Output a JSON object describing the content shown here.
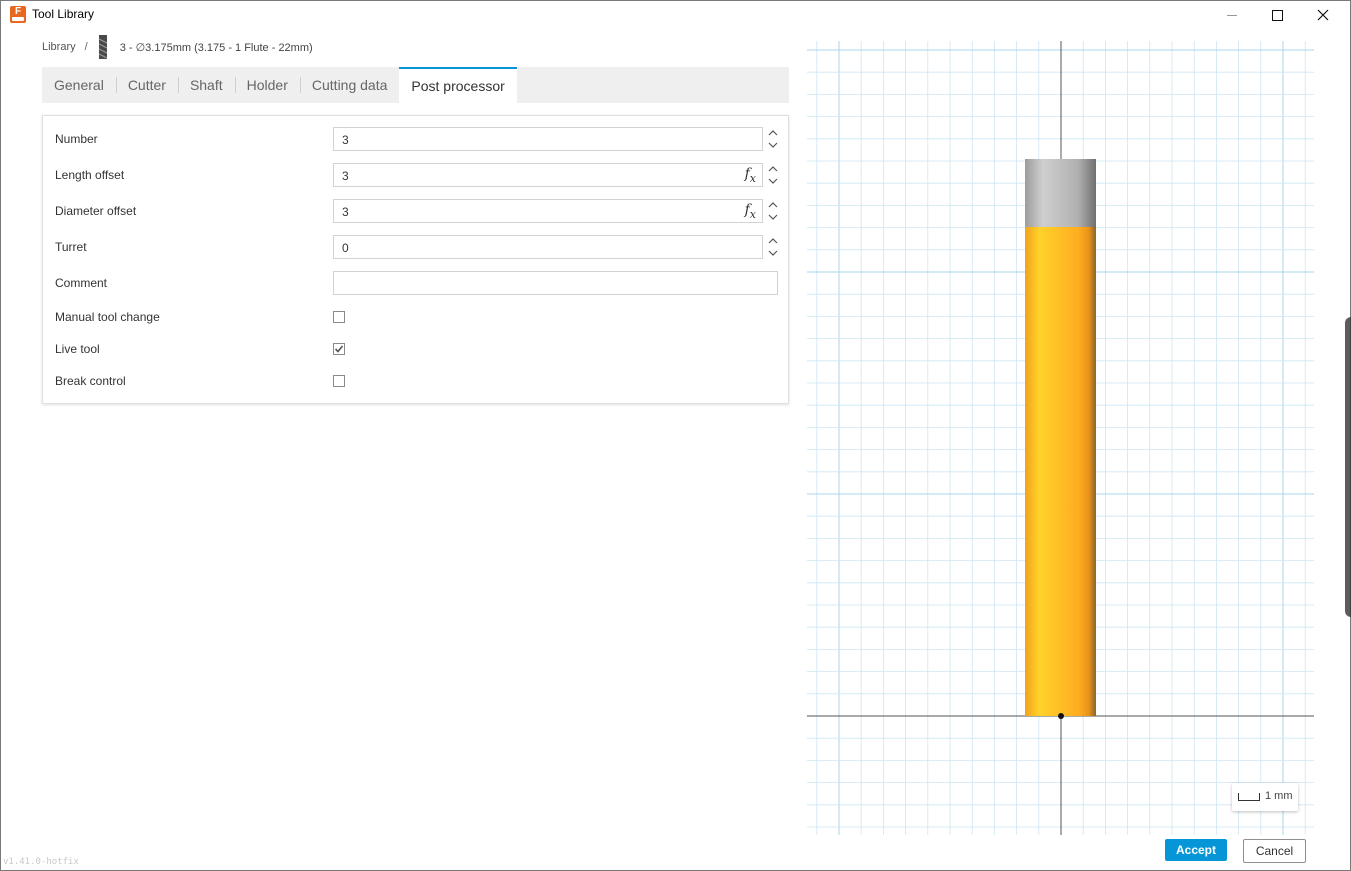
{
  "window": {
    "title": "Tool Library",
    "app_icon_letter": "F"
  },
  "breadcrumb": {
    "root": "Library",
    "separator": "/",
    "tool": "3 - ∅3.175mm (3.175 - 1 Flute - 22mm)"
  },
  "tabs": [
    {
      "label": "General",
      "active": false
    },
    {
      "label": "Cutter",
      "active": false
    },
    {
      "label": "Shaft",
      "active": false
    },
    {
      "label": "Holder",
      "active": false
    },
    {
      "label": "Cutting data",
      "active": false
    },
    {
      "label": "Post processor",
      "active": true
    }
  ],
  "form": {
    "number": {
      "label": "Number",
      "value": "3"
    },
    "length_offset": {
      "label": "Length offset",
      "value": "3"
    },
    "diameter_offset": {
      "label": "Diameter offset",
      "value": "3"
    },
    "turret": {
      "label": "Turret",
      "value": "0"
    },
    "comment": {
      "label": "Comment",
      "value": ""
    },
    "manual_tool_change": {
      "label": "Manual tool change",
      "checked": false
    },
    "live_tool": {
      "label": "Live tool",
      "checked": true
    },
    "break_control": {
      "label": "Break control",
      "checked": false
    },
    "fx_label": "f",
    "fx_sub": "x"
  },
  "preview": {
    "scale_label": "1 mm",
    "body_color": "#ffb31a",
    "holder_color": "#b8b8b8",
    "grid_color": "#cde6f3"
  },
  "footer": {
    "version": "v1.41.0-hotfix",
    "accept_label": "Accept",
    "cancel_label": "Cancel"
  },
  "colors": {
    "accent": "#0696d7"
  }
}
